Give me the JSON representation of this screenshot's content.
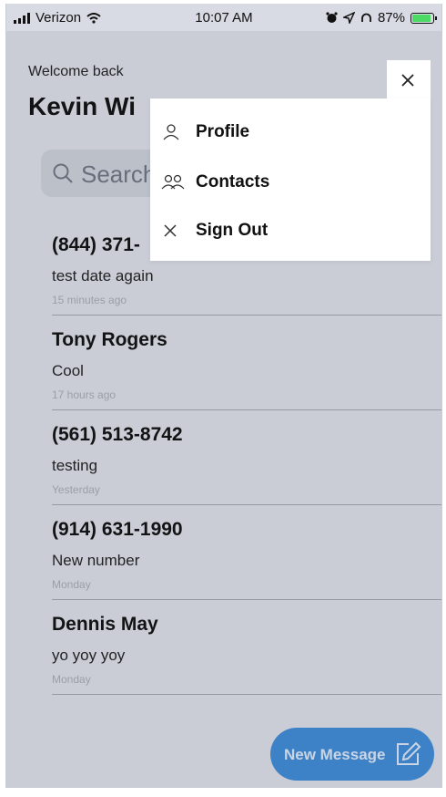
{
  "status_bar": {
    "carrier": "Verizon",
    "time": "10:07 AM",
    "battery_percent": "87%",
    "battery_level": 0.87,
    "icons": [
      "signal-icon",
      "wifi-icon",
      "alarm-icon",
      "location-icon",
      "headphones-icon",
      "battery-icon"
    ]
  },
  "header": {
    "welcome": "Welcome back",
    "user_name": "Kevin Wi"
  },
  "search": {
    "placeholder": "Search"
  },
  "menu": {
    "close_icon": "close-icon",
    "items": [
      {
        "label": "Profile",
        "icon": "person-icon"
      },
      {
        "label": "Contacts",
        "icon": "people-icon"
      },
      {
        "label": "Sign Out",
        "icon": "close-icon"
      }
    ]
  },
  "conversations": [
    {
      "name": "(844) 371-",
      "message": "test date again",
      "time": "15 minutes ago"
    },
    {
      "name": "Tony Rogers",
      "message": "Cool",
      "time": "17 hours ago"
    },
    {
      "name": "(561) 513-8742",
      "message": "testing",
      "time": "Yesterday"
    },
    {
      "name": "(914) 631-1990",
      "message": "New number",
      "time": "Monday"
    },
    {
      "name": "Dennis May",
      "message": "yo yoy yoy",
      "time": "Monday"
    }
  ],
  "new_message": {
    "label": "New Message",
    "icon": "compose-icon"
  },
  "colors": {
    "accent": "#3f89d2",
    "background": "#d8dbe3",
    "menu": "#ffffff"
  }
}
